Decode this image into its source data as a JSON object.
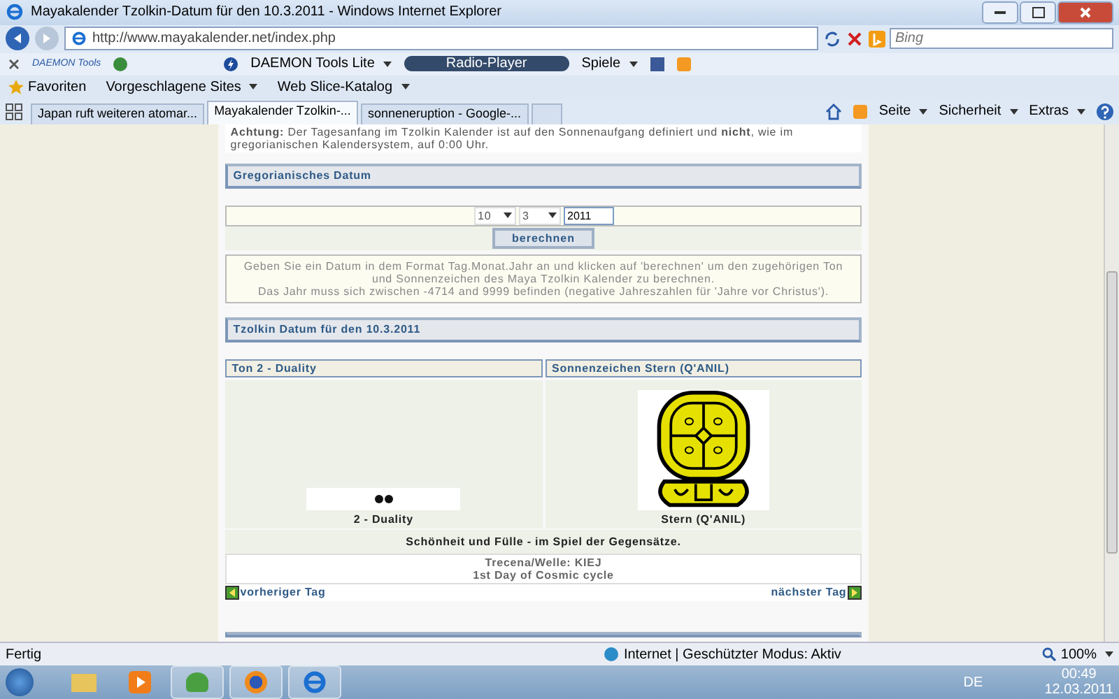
{
  "window": {
    "title": "Mayakalender Tzolkin-Datum für den 10.3.2011 - Windows Internet Explorer"
  },
  "address_bar": {
    "url": "http://www.mayakalender.net/index.php"
  },
  "search": {
    "placeholder": "Bing"
  },
  "toolbar": {
    "brand": "DAEMON Tools",
    "daemon_label": "DAEMON Tools Lite",
    "radio_label": "Radio-Player",
    "games_label": "Spiele"
  },
  "favorites_bar": {
    "favorites": "Favoriten",
    "items": [
      "Vorgeschlagene Sites",
      "Web Slice-Katalog"
    ]
  },
  "tabs": [
    {
      "label": "Japan ruft weiteren atomar...",
      "selected": false
    },
    {
      "label": "Mayakalender Tzolkin-...",
      "selected": true
    },
    {
      "label": "sonneneruption - Google-...",
      "selected": false
    }
  ],
  "command_bar": [
    "Seite",
    "Sicherheit",
    "Extras"
  ],
  "page": {
    "notice": "**Achtung:** Der Tagesanfang im Tzolkin Kalender ist auf den Sonnenaufgang definiert und **nicht**, wie im gregorianischen Kalendersystem, auf 0:00 Uhr.",
    "gregorian": {
      "title": "Gregorianisches Datum",
      "day": "10",
      "month": "3",
      "year": "2011",
      "button": "berechnen",
      "help": [
        "Geben Sie ein Datum in dem Format Tag.Monat.Jahr an und klicken auf 'berechnen' um den zugehörigen Ton und Sonnenzeichen des Maya Tzolkin Kalender zu berechnen.",
        "Das Jahr muss sich zwischen -4714 and 9999 befinden (negative Jahreszahlen für 'Jahre vor Christus')."
      ]
    },
    "tzolkin": {
      "title": "Tzolkin Datum für den 10.3.2011",
      "tone_title": "Ton 2 - Duality",
      "tone_caption": "2 - Duality",
      "sign_title": "Sonnenzeichen Stern (Q'ANIL)",
      "sign_caption": "Stern (Q'ANIL)",
      "meaning": "Schönheit und Fülle - im Spiel der Gegensätze.",
      "trecena": "Trecena/Welle: KIEJ",
      "cycle": "1st Day of Cosmic cycle",
      "prev": "vorheriger Tag",
      "next": "nächster Tag"
    }
  },
  "status_bar": {
    "text": "Fertig",
    "zone": "Internet | Geschützter Modus: Aktiv",
    "zoom": "100%"
  },
  "taskbar": {
    "language": "DE",
    "time": "00:49",
    "date": "12.03.2011"
  }
}
